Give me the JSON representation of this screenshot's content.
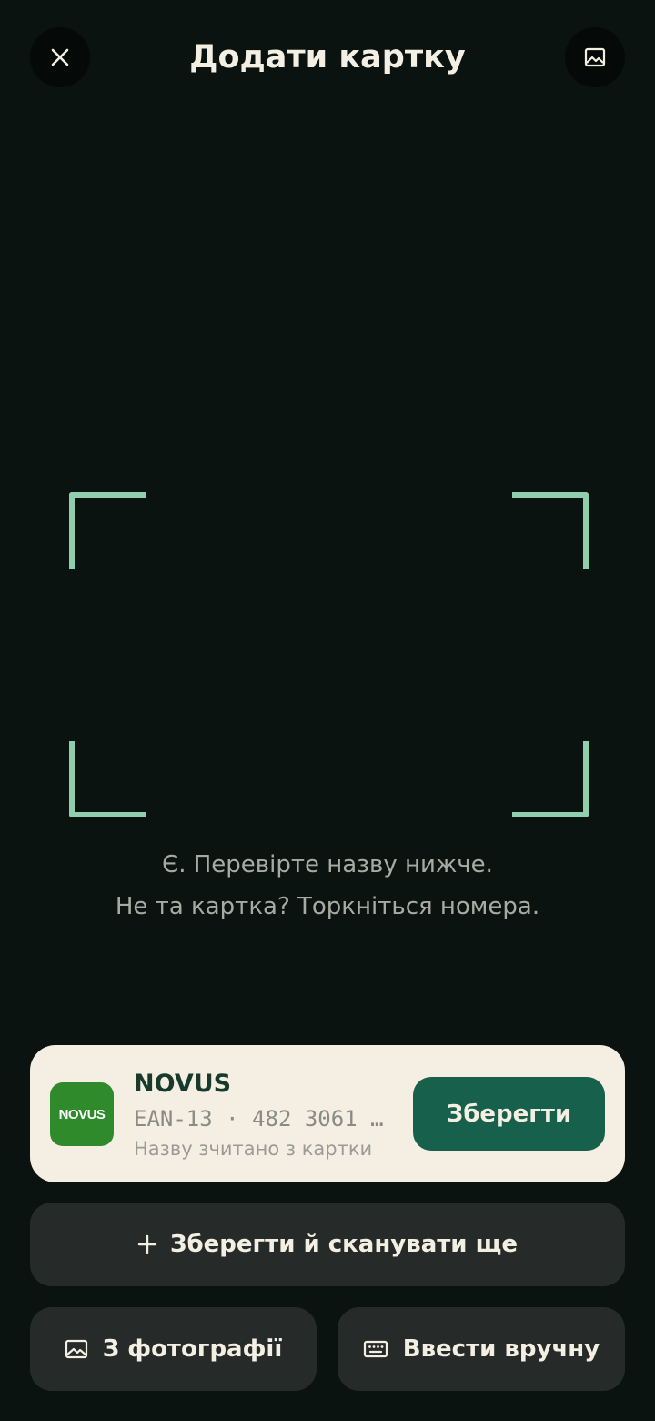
{
  "header": {
    "title": "Додати картку",
    "close_icon": "close-icon",
    "gallery_icon": "image-icon"
  },
  "scanner": {
    "frame_color": "#8fcfae",
    "hint_line1": "Є. Перевірте назву нижче.",
    "hint_line2": "Не та картка? Торкніться номера."
  },
  "result_card": {
    "logo_text": "NOVUS",
    "logo_color": "#2f8a2c",
    "store_name": "NOVUS",
    "code": "EAN-13 · 482 3061 …",
    "subtitle": "Назву зчитано з картки",
    "save_label": "Зберегти"
  },
  "actions": {
    "save_and_scan_label": "Зберегти й сканувати ще",
    "from_photo_label": "З фотографії",
    "manual_label": "Ввести вручну"
  },
  "colors": {
    "background": "#0a1310",
    "card_background": "#f4efe2",
    "primary": "#17604b",
    "secondary_button": "#262b29"
  }
}
